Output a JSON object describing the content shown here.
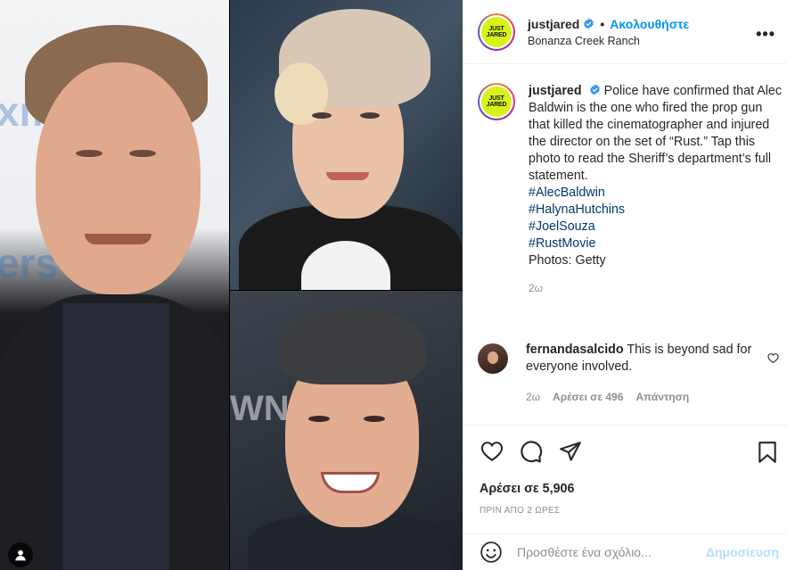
{
  "post": {
    "image_alt_panels": [
      "left-portrait",
      "top-right-portrait",
      "bottom-right-portrait"
    ]
  },
  "header": {
    "logo_line1": "JUST",
    "logo_line2": "JARED",
    "username": "justjared",
    "dot": "•",
    "follow_label": "Ακολουθήστε",
    "location": "Bonanza Creek Ranch",
    "more_label": "•••"
  },
  "caption": {
    "username": "justjared",
    "text": "Police have confirmed that Alec Baldwin is the one who fired the prop gun that killed the cinematographer and injured the director on the set of “Rust.” Tap this photo to read the Sheriff’s department’s full statement.",
    "hashtags": [
      "#AlecBaldwin",
      "#HalynaHutchins",
      "#JoelSouza",
      "#RustMovie"
    ],
    "credit": "Photos: Getty",
    "time": "2ω"
  },
  "comment": {
    "username": "fernandasalcido",
    "text": "This is beyond sad for everyone involved.",
    "time": "2ω",
    "likes": "Αρέσει σε 496",
    "reply_label": "Απάντηση"
  },
  "actions": {
    "likes": "Αρέσει σε 5,906",
    "time_ago": "ΠΡΙΝ ΑΠΟ 2 ΩΡΕΣ"
  },
  "add_comment": {
    "placeholder": "Προσθέστε ένα σχόλιο...",
    "post_label": "Δημοσίευση"
  },
  "colors": {
    "accent": "#0095f6",
    "hashtag": "#00376b",
    "muted": "#8e8e8e",
    "logo": "#d8f31a"
  }
}
